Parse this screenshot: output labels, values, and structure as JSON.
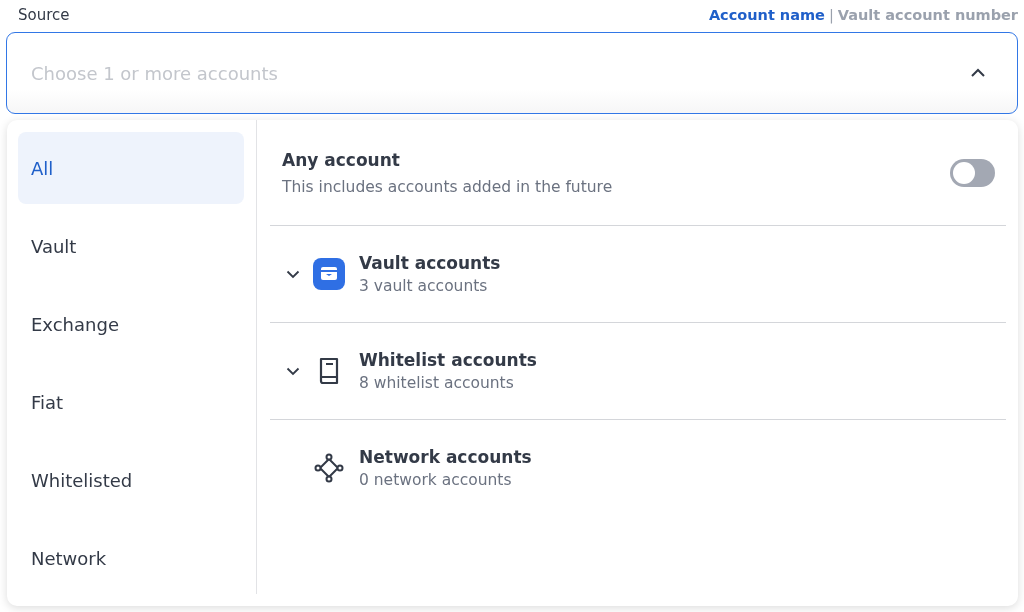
{
  "field": {
    "label": "Source",
    "placeholder": "Choose 1 or more accounts",
    "expanded": true
  },
  "display_options": [
    {
      "label": "Account name",
      "selected": true
    },
    {
      "label": "Vault account number",
      "selected": false
    }
  ],
  "display_separator": "|",
  "categories": [
    {
      "label": "All",
      "selected": true
    },
    {
      "label": "Vault",
      "selected": false
    },
    {
      "label": "Exchange",
      "selected": false
    },
    {
      "label": "Fiat",
      "selected": false
    },
    {
      "label": "Whitelisted",
      "selected": false
    },
    {
      "label": "Network",
      "selected": false
    }
  ],
  "any_account": {
    "title": "Any account",
    "description": "This includes accounts added in the future",
    "on": false
  },
  "groups": [
    {
      "kind": "vault",
      "title": "Vault accounts",
      "count": "3 vault accounts",
      "expandable": true
    },
    {
      "kind": "whitelist",
      "title": "Whitelist accounts",
      "count": "8 whitelist accounts",
      "expandable": true
    },
    {
      "kind": "network",
      "title": "Network accounts",
      "count": "0 network accounts",
      "expandable": false
    }
  ]
}
